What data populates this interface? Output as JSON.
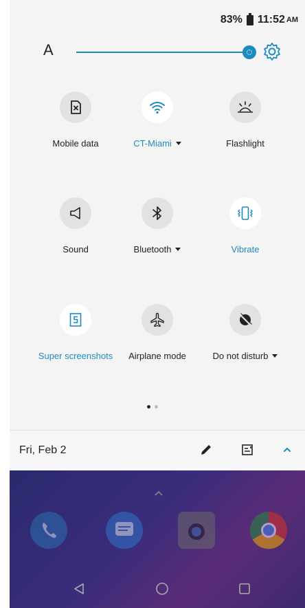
{
  "status": {
    "battery": "83%",
    "time": "11:52",
    "ampm": "AM"
  },
  "brightness": {
    "auto_label": "A",
    "level_percent": 95
  },
  "tiles": [
    {
      "label": "Mobile data",
      "icon": "mobile-data-off-icon",
      "active": false,
      "dropdown": false
    },
    {
      "label": "CT-Miami",
      "icon": "wifi-icon",
      "active": true,
      "dropdown": true
    },
    {
      "label": "Flashlight",
      "icon": "flashlight-icon",
      "active": false,
      "dropdown": false
    },
    {
      "label": "Sound",
      "icon": "speaker-icon",
      "active": false,
      "dropdown": false
    },
    {
      "label": "Bluetooth",
      "icon": "bluetooth-icon",
      "active": false,
      "dropdown": true
    },
    {
      "label": "Vibrate",
      "icon": "vibrate-icon",
      "active": true,
      "dropdown": false
    },
    {
      "label": "Super screenshots",
      "icon": "super-screenshot-icon",
      "active": true,
      "dropdown": false
    },
    {
      "label": "Airplane mode",
      "icon": "airplane-icon",
      "active": false,
      "dropdown": false
    },
    {
      "label": "Do not disturb",
      "icon": "do-not-disturb-icon",
      "active": false,
      "dropdown": true
    }
  ],
  "pager": {
    "current_page": 1,
    "total_pages": 2
  },
  "footer": {
    "date": "Fri, Feb 2"
  },
  "colors": {
    "accent": "#1e8bbf",
    "shade_bg": "#f4f4f4",
    "tile_bg": "#e2e2e2",
    "text": "#222222"
  }
}
